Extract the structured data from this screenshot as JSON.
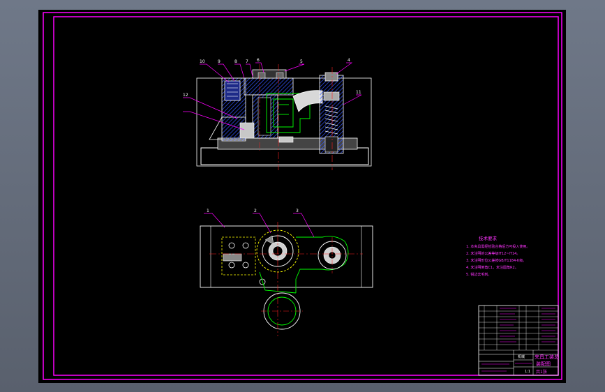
{
  "colors": {
    "viewport_bg": "#6b7586",
    "paper": "#000000",
    "frame": "#ff00ff",
    "outline": "#ffffff",
    "center_line": "#ff2020",
    "section_hatch": "#2a4dff",
    "hidden_part": "#00ff00",
    "leader": "#ff00ff",
    "note_text": "#ff33ff"
  },
  "drawing": {
    "front_view_part_numbers": [
      "10",
      "9",
      "8",
      "7",
      "6",
      "5",
      "4",
      "11",
      "12"
    ],
    "top_view_part_numbers": [
      "1",
      "2",
      "3"
    ]
  },
  "notes": {
    "title": "技术要求",
    "lines": [
      "1. 本夹具需经检验合格后方可投入使用。",
      "2. 未注明的公差等级IT12~IT14。",
      "3. 未注明形位公差按GB/T1184-K级。",
      "4. 未注明倒角C1，未注圆角R2。",
      "5. 锐边去毛刺。"
    ]
  },
  "title_block": {
    "name_line1": "夹具工装总",
    "name_line2": "装配图",
    "school": "机械",
    "scale": "1:1",
    "sheet": "共1张"
  }
}
